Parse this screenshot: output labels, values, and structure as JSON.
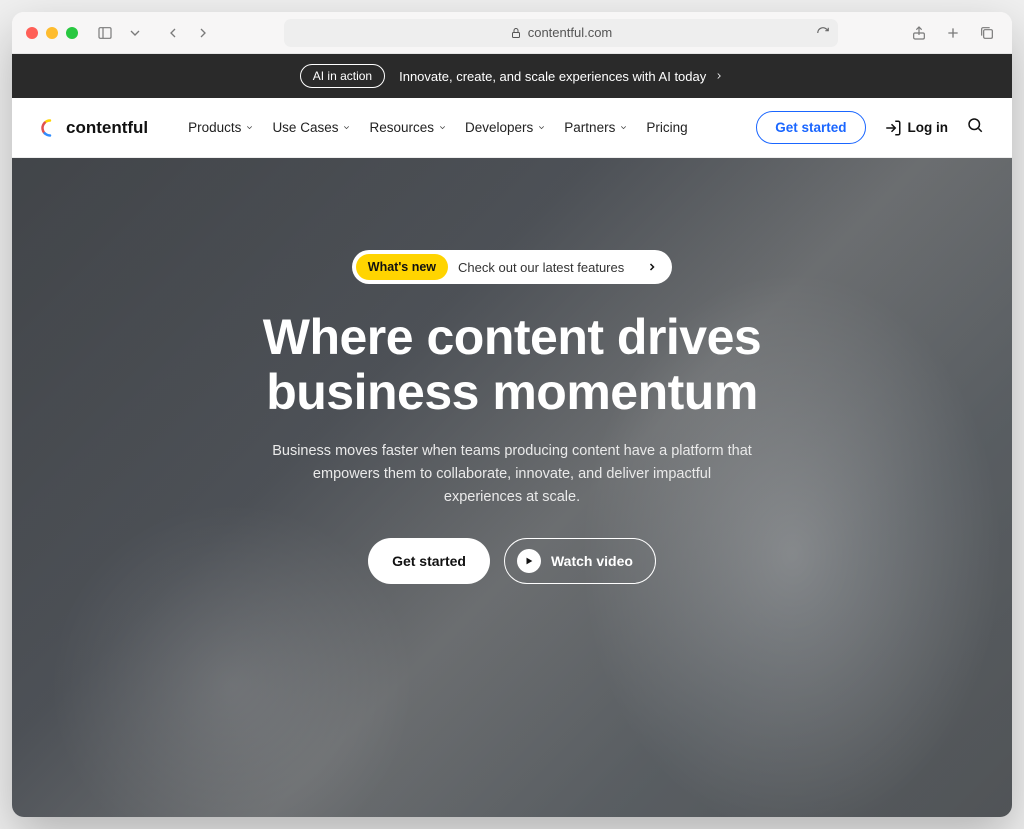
{
  "browser": {
    "url_host": "contentful.com"
  },
  "announce": {
    "pill": "AI in action",
    "text": "Innovate, create, and scale experiences with AI today"
  },
  "brand": {
    "name": "contentful"
  },
  "nav": {
    "items": [
      {
        "label": "Products",
        "has_dropdown": true
      },
      {
        "label": "Use Cases",
        "has_dropdown": true
      },
      {
        "label": "Resources",
        "has_dropdown": true
      },
      {
        "label": "Developers",
        "has_dropdown": true
      },
      {
        "label": "Partners",
        "has_dropdown": true
      },
      {
        "label": "Pricing",
        "has_dropdown": false
      }
    ],
    "cta": "Get started",
    "login": "Log in"
  },
  "hero": {
    "whats_new_badge": "What's new",
    "whats_new_text": "Check out our latest features",
    "headline": "Where content drives business momentum",
    "subhead": "Business moves faster when teams producing content have a platform that empowers them to collaborate, innovate, and deliver impactful experiences at scale.",
    "cta_primary": "Get started",
    "cta_secondary": "Watch video"
  }
}
